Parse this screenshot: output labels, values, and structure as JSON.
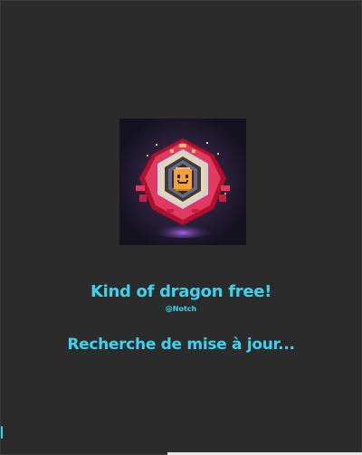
{
  "window": {
    "background": "#2b2b2b",
    "accent": "#3ad3f0"
  },
  "logo": {
    "icon": "pixel-dragon-emblem-icon"
  },
  "launcher": {
    "title": "Kind of dragon free!",
    "author": "@Notch",
    "status": "Recherche de mise à jour..."
  }
}
